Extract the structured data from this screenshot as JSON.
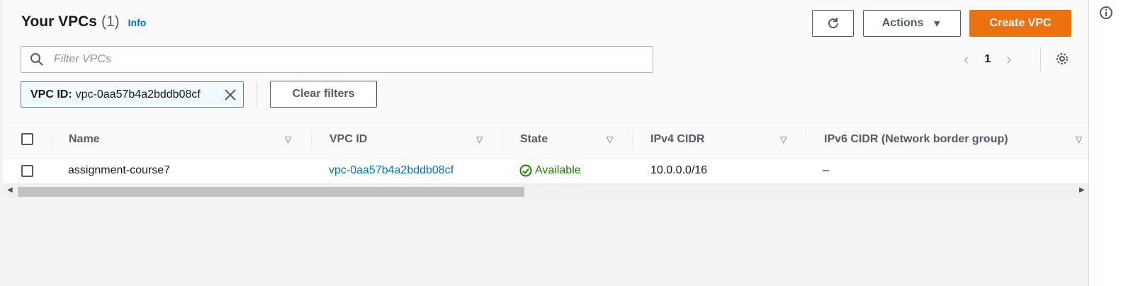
{
  "header": {
    "title": "Your VPCs",
    "count": "(1)",
    "info": "Info"
  },
  "toolbar": {
    "refresh_icon": "refresh-icon",
    "actions_label": "Actions",
    "create_label": "Create VPC"
  },
  "search": {
    "placeholder": "Filter VPCs",
    "value": ""
  },
  "pagination": {
    "page": "1"
  },
  "filter_token": {
    "key": "VPC ID:",
    "value": "vpc-0aa57b4a2bddb08cf"
  },
  "clear_filters_label": "Clear filters",
  "table": {
    "columns": [
      "Name",
      "VPC ID",
      "State",
      "IPv4 CIDR",
      "IPv6 CIDR (Network border group)"
    ],
    "rows": [
      {
        "name": "assignment-course7",
        "vpc_id": "vpc-0aa57b4a2bddb08cf",
        "state": "Available",
        "ipv4_cidr": "10.0.0.0/16",
        "ipv6_cidr": "–"
      }
    ]
  },
  "colors": {
    "primary": "#ec7211",
    "link": "#0073bb",
    "success": "#1d8102",
    "token_border": "#00a1c9"
  }
}
